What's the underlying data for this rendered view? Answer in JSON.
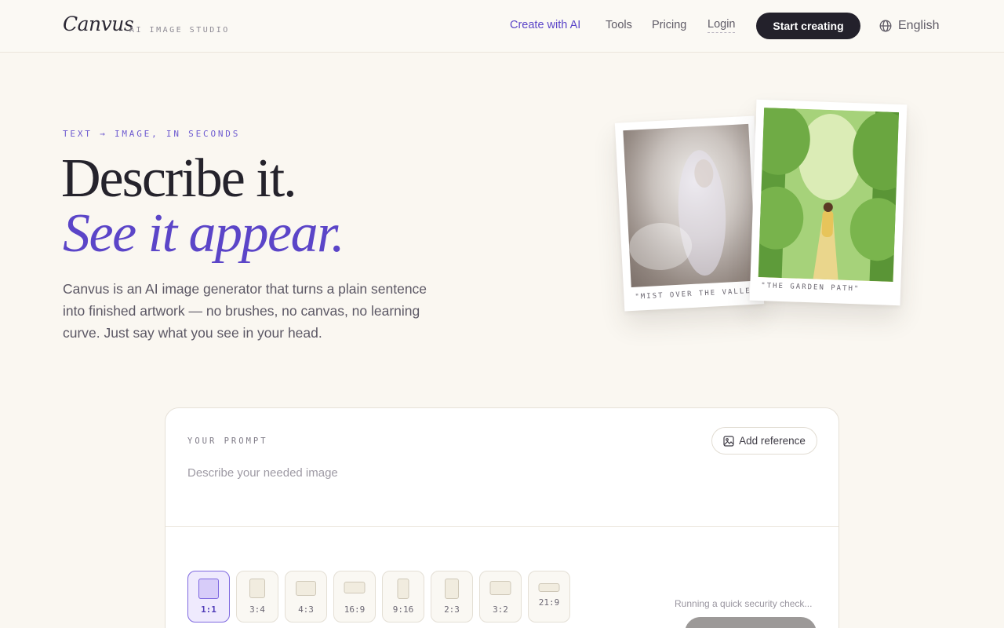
{
  "brand": {
    "name": "Canvus",
    "tagline": "AI IMAGE STUDIO"
  },
  "nav": {
    "links": [
      {
        "label": "Create with AI"
      },
      {
        "label": "Tools"
      },
      {
        "label": "Pricing"
      },
      {
        "label": "Login"
      }
    ],
    "cta": "Start creating",
    "language": "English",
    "accent_color": "#5b45c8"
  },
  "hero": {
    "eyebrow": "TEXT → IMAGE, IN SECONDS",
    "title_line1": "Describe it.",
    "title_line2": "See it appear.",
    "description": "Canvus is an AI image generator that turns a plain sentence into finished artwork — no brushes, no canvas, no learning curve. Just say what you see in your head."
  },
  "gallery": [
    {
      "caption": "\"MIST OVER THE VALLEY\""
    },
    {
      "caption": "\"THE GARDEN PATH\""
    }
  ],
  "prompt": {
    "label": "YOUR PROMPT",
    "add_reference": "Add reference",
    "placeholder": "Describe your needed image",
    "value": "",
    "status": "Running a quick security check..."
  },
  "aspect_ratios": {
    "selected": "1:1",
    "options": [
      "1:1",
      "3:4",
      "4:3",
      "16:9",
      "9:16",
      "2:3",
      "3:2",
      "21:9"
    ]
  }
}
